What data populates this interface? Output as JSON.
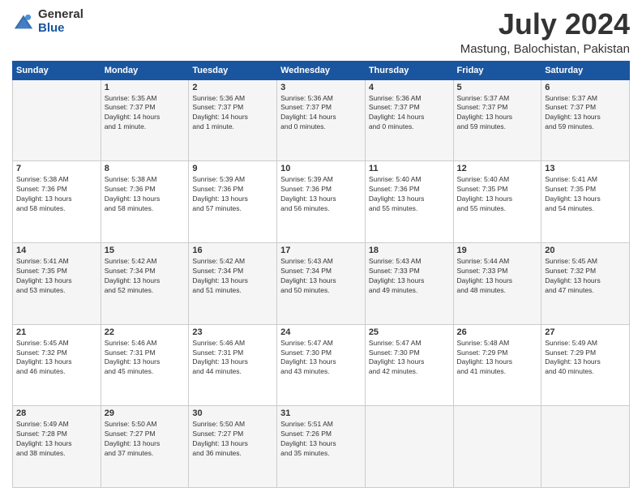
{
  "header": {
    "logo_general": "General",
    "logo_blue": "Blue",
    "month_title": "July 2024",
    "location": "Mastung, Balochistan, Pakistan"
  },
  "weekdays": [
    "Sunday",
    "Monday",
    "Tuesday",
    "Wednesday",
    "Thursday",
    "Friday",
    "Saturday"
  ],
  "weeks": [
    [
      {
        "day": "",
        "info": ""
      },
      {
        "day": "1",
        "info": "Sunrise: 5:35 AM\nSunset: 7:37 PM\nDaylight: 14 hours\nand 1 minute."
      },
      {
        "day": "2",
        "info": "Sunrise: 5:36 AM\nSunset: 7:37 PM\nDaylight: 14 hours\nand 1 minute."
      },
      {
        "day": "3",
        "info": "Sunrise: 5:36 AM\nSunset: 7:37 PM\nDaylight: 14 hours\nand 0 minutes."
      },
      {
        "day": "4",
        "info": "Sunrise: 5:36 AM\nSunset: 7:37 PM\nDaylight: 14 hours\nand 0 minutes."
      },
      {
        "day": "5",
        "info": "Sunrise: 5:37 AM\nSunset: 7:37 PM\nDaylight: 13 hours\nand 59 minutes."
      },
      {
        "day": "6",
        "info": "Sunrise: 5:37 AM\nSunset: 7:37 PM\nDaylight: 13 hours\nand 59 minutes."
      }
    ],
    [
      {
        "day": "7",
        "info": "Sunrise: 5:38 AM\nSunset: 7:36 PM\nDaylight: 13 hours\nand 58 minutes."
      },
      {
        "day": "8",
        "info": "Sunrise: 5:38 AM\nSunset: 7:36 PM\nDaylight: 13 hours\nand 58 minutes."
      },
      {
        "day": "9",
        "info": "Sunrise: 5:39 AM\nSunset: 7:36 PM\nDaylight: 13 hours\nand 57 minutes."
      },
      {
        "day": "10",
        "info": "Sunrise: 5:39 AM\nSunset: 7:36 PM\nDaylight: 13 hours\nand 56 minutes."
      },
      {
        "day": "11",
        "info": "Sunrise: 5:40 AM\nSunset: 7:36 PM\nDaylight: 13 hours\nand 55 minutes."
      },
      {
        "day": "12",
        "info": "Sunrise: 5:40 AM\nSunset: 7:35 PM\nDaylight: 13 hours\nand 55 minutes."
      },
      {
        "day": "13",
        "info": "Sunrise: 5:41 AM\nSunset: 7:35 PM\nDaylight: 13 hours\nand 54 minutes."
      }
    ],
    [
      {
        "day": "14",
        "info": "Sunrise: 5:41 AM\nSunset: 7:35 PM\nDaylight: 13 hours\nand 53 minutes."
      },
      {
        "day": "15",
        "info": "Sunrise: 5:42 AM\nSunset: 7:34 PM\nDaylight: 13 hours\nand 52 minutes."
      },
      {
        "day": "16",
        "info": "Sunrise: 5:42 AM\nSunset: 7:34 PM\nDaylight: 13 hours\nand 51 minutes."
      },
      {
        "day": "17",
        "info": "Sunrise: 5:43 AM\nSunset: 7:34 PM\nDaylight: 13 hours\nand 50 minutes."
      },
      {
        "day": "18",
        "info": "Sunrise: 5:43 AM\nSunset: 7:33 PM\nDaylight: 13 hours\nand 49 minutes."
      },
      {
        "day": "19",
        "info": "Sunrise: 5:44 AM\nSunset: 7:33 PM\nDaylight: 13 hours\nand 48 minutes."
      },
      {
        "day": "20",
        "info": "Sunrise: 5:45 AM\nSunset: 7:32 PM\nDaylight: 13 hours\nand 47 minutes."
      }
    ],
    [
      {
        "day": "21",
        "info": "Sunrise: 5:45 AM\nSunset: 7:32 PM\nDaylight: 13 hours\nand 46 minutes."
      },
      {
        "day": "22",
        "info": "Sunrise: 5:46 AM\nSunset: 7:31 PM\nDaylight: 13 hours\nand 45 minutes."
      },
      {
        "day": "23",
        "info": "Sunrise: 5:46 AM\nSunset: 7:31 PM\nDaylight: 13 hours\nand 44 minutes."
      },
      {
        "day": "24",
        "info": "Sunrise: 5:47 AM\nSunset: 7:30 PM\nDaylight: 13 hours\nand 43 minutes."
      },
      {
        "day": "25",
        "info": "Sunrise: 5:47 AM\nSunset: 7:30 PM\nDaylight: 13 hours\nand 42 minutes."
      },
      {
        "day": "26",
        "info": "Sunrise: 5:48 AM\nSunset: 7:29 PM\nDaylight: 13 hours\nand 41 minutes."
      },
      {
        "day": "27",
        "info": "Sunrise: 5:49 AM\nSunset: 7:29 PM\nDaylight: 13 hours\nand 40 minutes."
      }
    ],
    [
      {
        "day": "28",
        "info": "Sunrise: 5:49 AM\nSunset: 7:28 PM\nDaylight: 13 hours\nand 38 minutes."
      },
      {
        "day": "29",
        "info": "Sunrise: 5:50 AM\nSunset: 7:27 PM\nDaylight: 13 hours\nand 37 minutes."
      },
      {
        "day": "30",
        "info": "Sunrise: 5:50 AM\nSunset: 7:27 PM\nDaylight: 13 hours\nand 36 minutes."
      },
      {
        "day": "31",
        "info": "Sunrise: 5:51 AM\nSunset: 7:26 PM\nDaylight: 13 hours\nand 35 minutes."
      },
      {
        "day": "",
        "info": ""
      },
      {
        "day": "",
        "info": ""
      },
      {
        "day": "",
        "info": ""
      }
    ]
  ]
}
